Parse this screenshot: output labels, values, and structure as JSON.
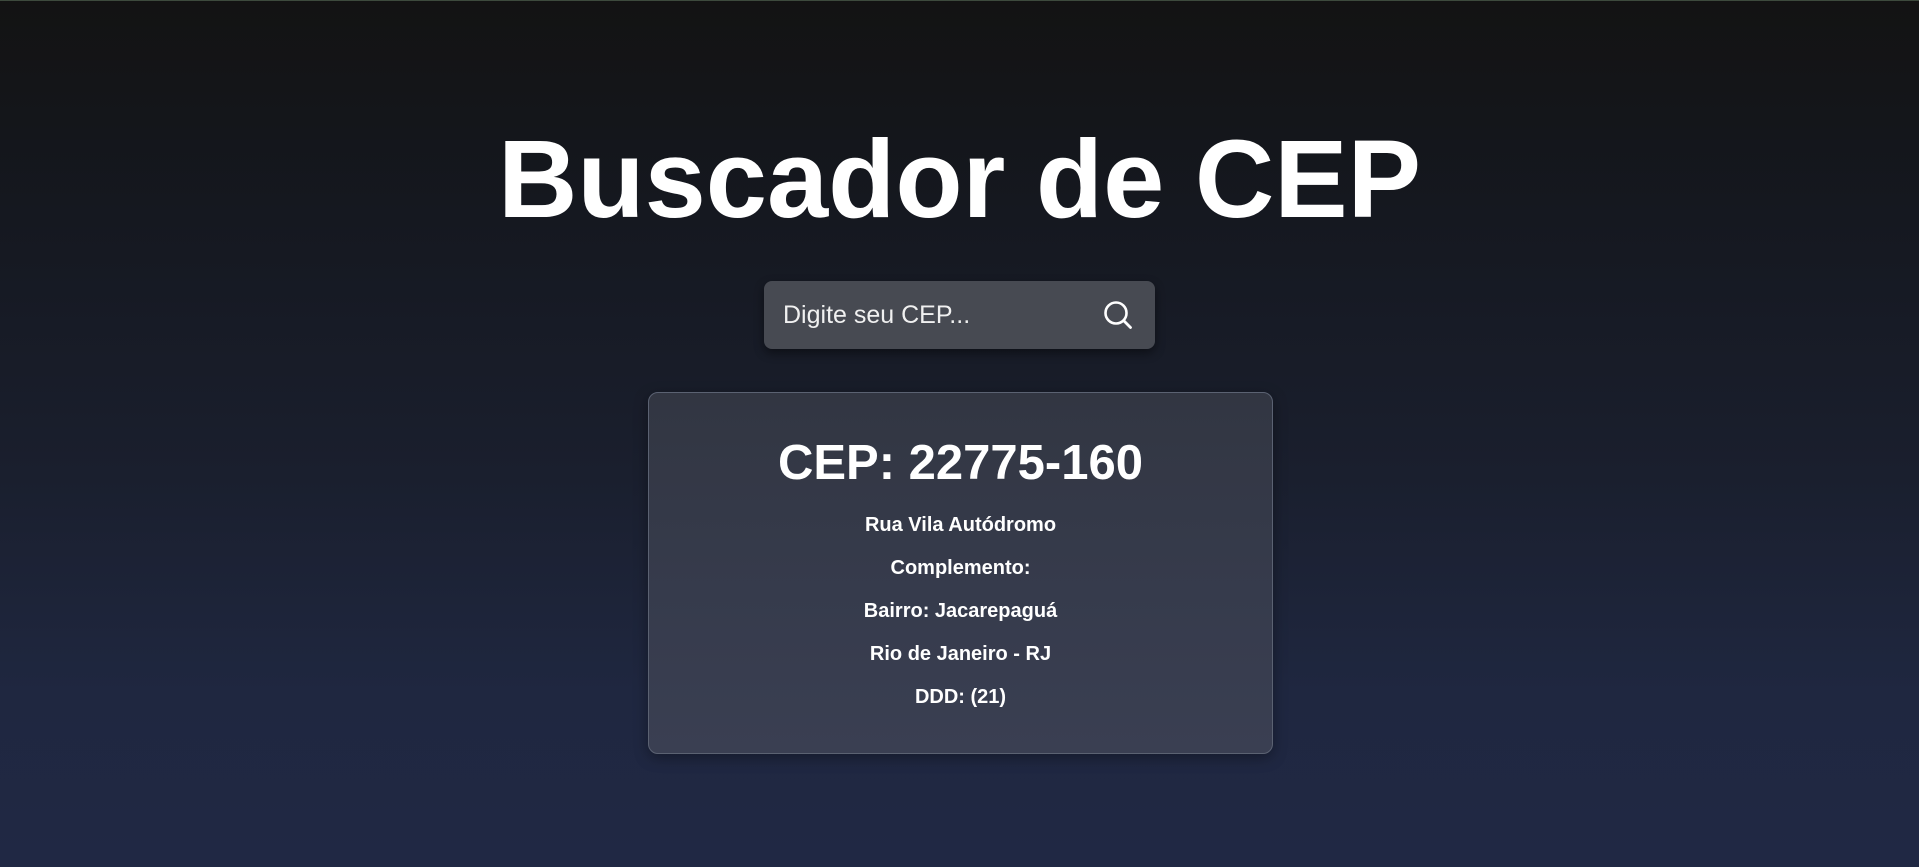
{
  "page": {
    "title": "Buscador de CEP"
  },
  "search": {
    "placeholder": "Digite seu CEP...",
    "value": "",
    "button_icon": "search-icon"
  },
  "result": {
    "cep_label": "CEP: 22775-160",
    "logradouro": "Rua Vila Autódromo",
    "complemento": "Complemento:",
    "bairro": "Bairro: Jacarepaguá",
    "cidade_uf": "Rio de Janeiro - RJ",
    "ddd": "DDD: (21)"
  },
  "colors": {
    "background_top": "#131313",
    "background_bottom": "#202844",
    "search_box": "#474a52",
    "card_background": "#363b4c",
    "text": "#ffffff"
  }
}
